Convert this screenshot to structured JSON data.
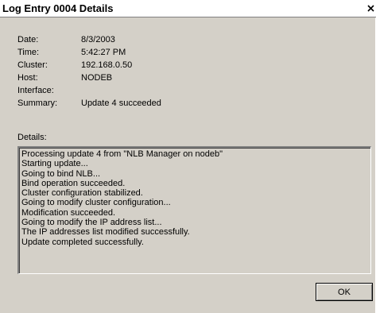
{
  "window": {
    "title": "Log Entry 0004 Details",
    "close_icon": "close-icon"
  },
  "fields": [
    {
      "label": "Date:",
      "value": "8/3/2003"
    },
    {
      "label": "Time:",
      "value": "5:42:27 PM"
    },
    {
      "label": "Cluster:",
      "value": "192.168.0.50"
    },
    {
      "label": "Host:",
      "value": "NODEB"
    },
    {
      "label": "Interface:",
      "value": ""
    },
    {
      "label": "Summary:",
      "value": "Update 4 succeeded"
    }
  ],
  "details": {
    "label": "Details:",
    "lines": [
      "Processing update 4 from \"NLB Manager on nodeb\"",
      "Starting update...",
      "Going to bind NLB...",
      "Bind operation succeeded.",
      "Cluster configuration stabilized.",
      "Going to modify cluster configuration...",
      "Modification succeeded.",
      "Going to modify the IP address list...",
      "The IP addresses list modified successfully.",
      "Update completed successfully."
    ]
  },
  "buttons": {
    "ok_label": "OK"
  }
}
